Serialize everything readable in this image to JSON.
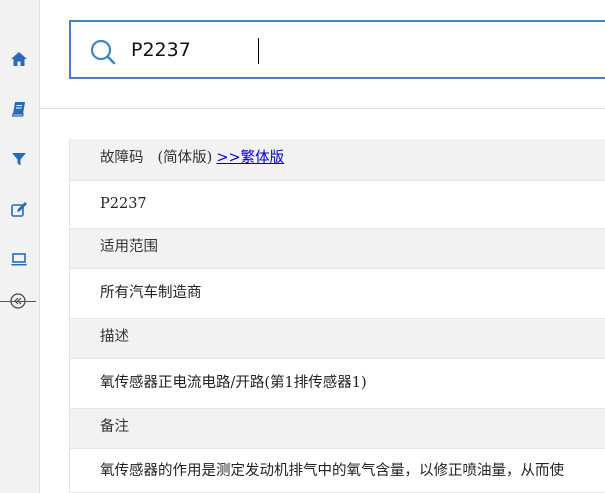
{
  "search": {
    "value": "P2237"
  },
  "table": {
    "code_label": "故障码",
    "variant_current": "(简体版)",
    "variant_link": ">>繁体版",
    "code_value": "P2237",
    "scope_label": "适用范围",
    "scope_value": "所有汽车制造商",
    "desc_label": "描述",
    "desc_value": "氧传感器正电流电路/开路(第1排传感器1)",
    "note_label": "备注",
    "note_value": "氧传感器的作用是测定发动机排气中的氧气含量，以修正喷油量，从而使"
  }
}
